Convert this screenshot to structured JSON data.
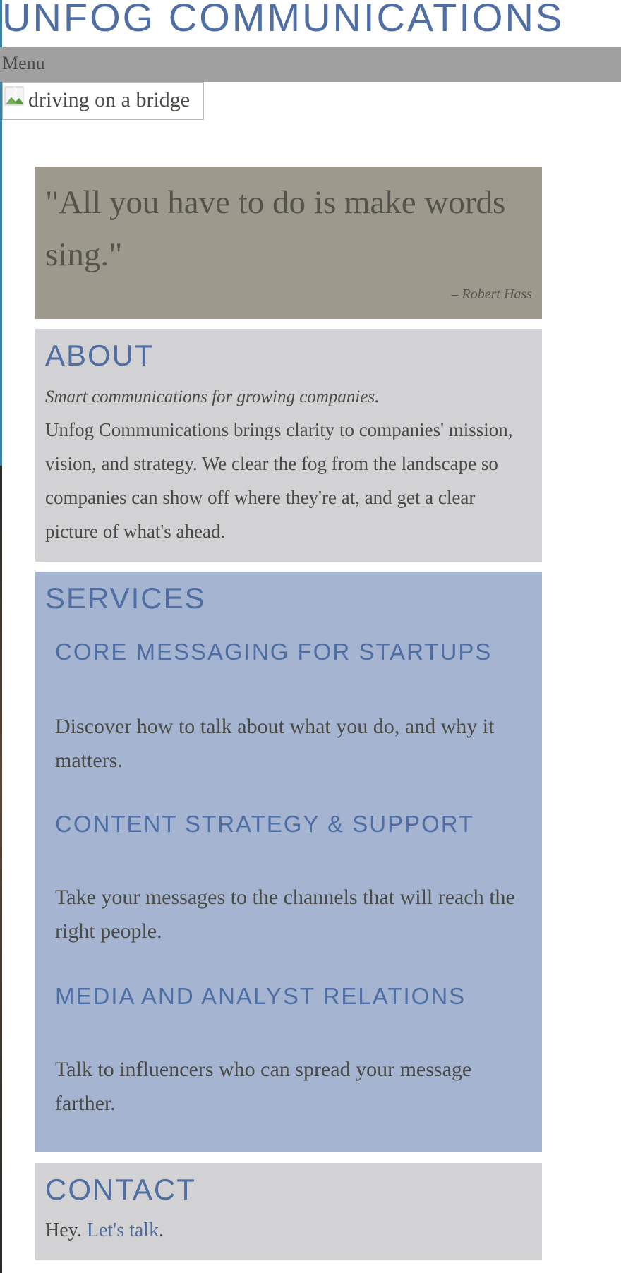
{
  "site": {
    "title": "UNFOG COMMUNICATIONS"
  },
  "nav": {
    "menu_label": "Menu"
  },
  "hero": {
    "alt": "driving on a bridge",
    "icon": "broken-image-icon"
  },
  "quote": {
    "text": "\"All you have to do is make words sing.\"",
    "author": "– Robert Hass"
  },
  "about": {
    "heading": "ABOUT",
    "tagline": "Smart communications for growing companies.",
    "body": "Unfog Communications brings clarity to companies' mission, vision, and strategy. We clear the fog from the landscape so companies can show off where they're at, and get a clear picture of what's ahead."
  },
  "services": {
    "heading": "SERVICES",
    "items": [
      {
        "title": "CORE MESSAGING FOR STARTUPS",
        "description": "Discover how to talk about what you do, and why it matters."
      },
      {
        "title": "CONTENT STRATEGY & SUPPORT",
        "description": "Take your messages to the channels that will reach the right people."
      },
      {
        "title": "MEDIA AND ANALYST RELATIONS",
        "description": "Talk to influencers who can spread your message farther."
      }
    ]
  },
  "contact": {
    "heading": "CONTACT",
    "prefix": "Hey. ",
    "link": "Let's talk",
    "suffix": "."
  },
  "colors": {
    "heading": "#4e6ea4",
    "menu_bar": "#a0a0a0",
    "quote_panel": "#9d9a8d",
    "about_panel": "#d2d2d4",
    "services_panel": "#a5b5d1",
    "text": "#4a4a46"
  }
}
